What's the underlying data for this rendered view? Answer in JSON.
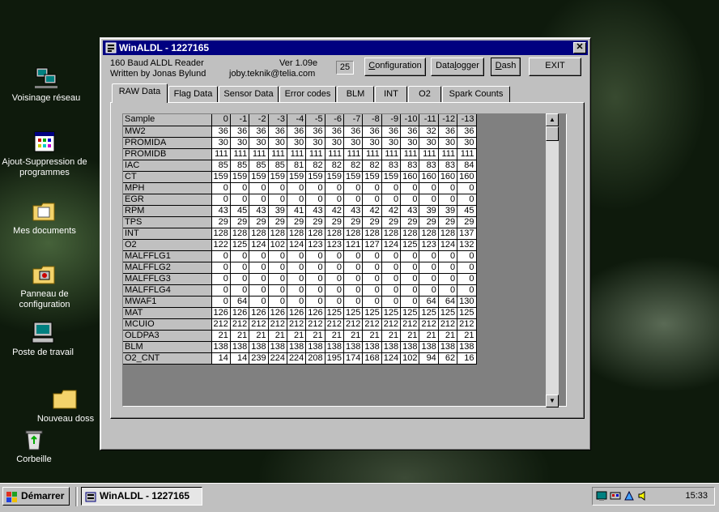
{
  "desktop": {
    "icons": [
      {
        "id": "voisinage",
        "label": "Voisinage réseau"
      },
      {
        "id": "ajout",
        "label": "Ajout-Suppression de programmes"
      },
      {
        "id": "mesdocs",
        "label": "Mes documents"
      },
      {
        "id": "panneau",
        "label": "Panneau de configuration"
      },
      {
        "id": "poste",
        "label": "Poste de travail"
      },
      {
        "id": "nouveau",
        "label": "Nouveau doss"
      },
      {
        "id": "corbeille",
        "label": "Corbeille"
      }
    ]
  },
  "window": {
    "title": "WinALDL - 1227165",
    "close": "✕",
    "info_line1": "160 Baud ALDL Reader",
    "info_line2": "Written by Jonas Bylund",
    "version": "Ver 1.09e",
    "email": "joby.teknik@telia.com",
    "counter": "25",
    "buttons": {
      "configuration": {
        "pre": "",
        "u": "C",
        "post": "onfiguration"
      },
      "datalogger": {
        "pre": "Data",
        "u": "l",
        "post": "ogger"
      },
      "dash": {
        "pre": "",
        "u": "D",
        "post": "ash"
      },
      "exit": "EXIT"
    },
    "tabs": [
      "RAW Data",
      "Flag Data",
      "Sensor Data",
      "Error codes",
      "BLM",
      "INT",
      "O2",
      "Spark Counts"
    ],
    "active_tab": "RAW Data",
    "table": {
      "header_label": "Sample",
      "columns": [
        "0",
        "-1",
        "-2",
        "-3",
        "-4",
        "-5",
        "-6",
        "-7",
        "-8",
        "-9",
        "-10",
        "-11",
        "-12",
        "-13"
      ],
      "rows": [
        {
          "name": "MW2",
          "values": [
            "36",
            "36",
            "36",
            "36",
            "36",
            "36",
            "36",
            "36",
            "36",
            "36",
            "36",
            "32",
            "36",
            "36"
          ]
        },
        {
          "name": "PROMIDA",
          "values": [
            "30",
            "30",
            "30",
            "30",
            "30",
            "30",
            "30",
            "30",
            "30",
            "30",
            "30",
            "30",
            "30",
            "30"
          ]
        },
        {
          "name": "PROMIDB",
          "values": [
            "111",
            "111",
            "111",
            "111",
            "111",
            "111",
            "111",
            "111",
            "111",
            "111",
            "111",
            "111",
            "111",
            "111"
          ]
        },
        {
          "name": "IAC",
          "values": [
            "85",
            "85",
            "85",
            "85",
            "81",
            "82",
            "82",
            "82",
            "82",
            "83",
            "83",
            "83",
            "83",
            "84"
          ]
        },
        {
          "name": "CT",
          "values": [
            "159",
            "159",
            "159",
            "159",
            "159",
            "159",
            "159",
            "159",
            "159",
            "159",
            "160",
            "160",
            "160",
            "160"
          ]
        },
        {
          "name": "MPH",
          "values": [
            "0",
            "0",
            "0",
            "0",
            "0",
            "0",
            "0",
            "0",
            "0",
            "0",
            "0",
            "0",
            "0",
            "0"
          ]
        },
        {
          "name": "EGR",
          "values": [
            "0",
            "0",
            "0",
            "0",
            "0",
            "0",
            "0",
            "0",
            "0",
            "0",
            "0",
            "0",
            "0",
            "0"
          ]
        },
        {
          "name": "RPM",
          "values": [
            "43",
            "45",
            "43",
            "39",
            "41",
            "43",
            "42",
            "43",
            "42",
            "42",
            "43",
            "39",
            "39",
            "45"
          ]
        },
        {
          "name": "TPS",
          "values": [
            "29",
            "29",
            "29",
            "29",
            "29",
            "29",
            "29",
            "29",
            "29",
            "29",
            "29",
            "29",
            "29",
            "29"
          ]
        },
        {
          "name": "INT",
          "values": [
            "128",
            "128",
            "128",
            "128",
            "128",
            "128",
            "128",
            "128",
            "128",
            "128",
            "128",
            "128",
            "128",
            "137"
          ]
        },
        {
          "name": "O2",
          "values": [
            "122",
            "125",
            "124",
            "102",
            "124",
            "123",
            "123",
            "121",
            "127",
            "124",
            "125",
            "123",
            "124",
            "132"
          ]
        },
        {
          "name": "MALFFLG1",
          "values": [
            "0",
            "0",
            "0",
            "0",
            "0",
            "0",
            "0",
            "0",
            "0",
            "0",
            "0",
            "0",
            "0",
            "0"
          ]
        },
        {
          "name": "MALFFLG2",
          "values": [
            "0",
            "0",
            "0",
            "0",
            "0",
            "0",
            "0",
            "0",
            "0",
            "0",
            "0",
            "0",
            "0",
            "0"
          ]
        },
        {
          "name": "MALFFLG3",
          "values": [
            "0",
            "0",
            "0",
            "0",
            "0",
            "0",
            "0",
            "0",
            "0",
            "0",
            "0",
            "0",
            "0",
            "0"
          ]
        },
        {
          "name": "MALFFLG4",
          "values": [
            "0",
            "0",
            "0",
            "0",
            "0",
            "0",
            "0",
            "0",
            "0",
            "0",
            "0",
            "0",
            "0",
            "0"
          ]
        },
        {
          "name": "MWAF1",
          "values": [
            "0",
            "64",
            "0",
            "0",
            "0",
            "0",
            "0",
            "0",
            "0",
            "0",
            "0",
            "64",
            "64",
            "130"
          ]
        },
        {
          "name": "MAT",
          "values": [
            "126",
            "126",
            "126",
            "126",
            "126",
            "126",
            "125",
            "125",
            "125",
            "125",
            "125",
            "125",
            "125",
            "125"
          ]
        },
        {
          "name": "MCUIO",
          "values": [
            "212",
            "212",
            "212",
            "212",
            "212",
            "212",
            "212",
            "212",
            "212",
            "212",
            "212",
            "212",
            "212",
            "212"
          ]
        },
        {
          "name": "OLDPA3",
          "values": [
            "21",
            "21",
            "21",
            "21",
            "21",
            "21",
            "21",
            "21",
            "21",
            "21",
            "21",
            "21",
            "21",
            "21"
          ]
        },
        {
          "name": "BLM",
          "values": [
            "138",
            "138",
            "138",
            "138",
            "138",
            "138",
            "138",
            "138",
            "138",
            "138",
            "138",
            "138",
            "138",
            "138"
          ]
        },
        {
          "name": "O2_CNT",
          "values": [
            "14",
            "14",
            "239",
            "224",
            "224",
            "208",
            "195",
            "174",
            "168",
            "124",
            "102",
            "94",
            "62",
            "16"
          ]
        }
      ]
    }
  },
  "taskbar": {
    "start": "Démarrer",
    "task": "WinALDL - 1227165",
    "clock": "15:33"
  }
}
